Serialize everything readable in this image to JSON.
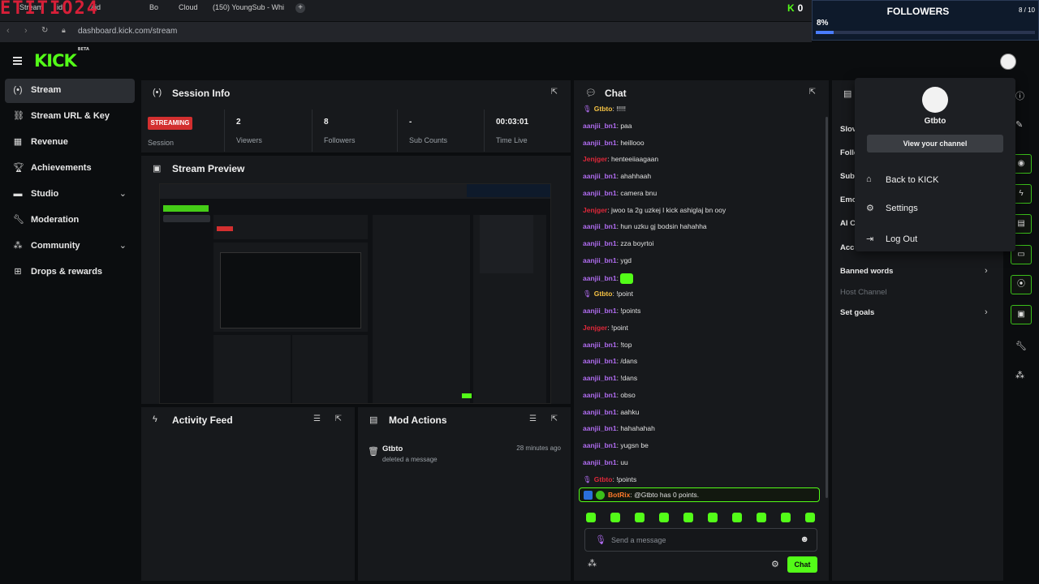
{
  "browser": {
    "tabs": [
      "Stream",
      "id",
      "aid",
      "Bo",
      "Cloud",
      "(150) YoungSub - Whi"
    ],
    "new_tab": "+",
    "url": "dashboard.kick.com/stream",
    "overlay_text": "ETITIO24"
  },
  "followers_widget": {
    "title": "FOLLOWERS",
    "count": "8 / 10",
    "percent_label": "8%",
    "progress": 0.08,
    "kick_count": "0"
  },
  "header": {
    "logo": "KICK",
    "logo_badge": "BETA"
  },
  "sidebar": {
    "items": [
      {
        "label": "Stream",
        "icon": "broadcast-icon",
        "active": true
      },
      {
        "label": "Stream URL & Key",
        "icon": "link-icon"
      },
      {
        "label": "Revenue",
        "icon": "revenue-icon"
      },
      {
        "label": "Achievements",
        "icon": "trophy-icon"
      },
      {
        "label": "Studio",
        "icon": "studio-icon",
        "expandable": true
      },
      {
        "label": "Moderation",
        "icon": "wrench-icon"
      },
      {
        "label": "Community",
        "icon": "community-icon",
        "expandable": true
      },
      {
        "label": "Drops & rewards",
        "icon": "drops-icon"
      }
    ]
  },
  "session_info": {
    "title": "Session Info",
    "status_badge": "STREAMING",
    "status_label": "Session",
    "stats": [
      {
        "value": "2",
        "label": "Viewers"
      },
      {
        "value": "8",
        "label": "Followers"
      },
      {
        "value": "-",
        "label": "Sub Counts"
      },
      {
        "value": "00:03:01",
        "label": "Time Live"
      }
    ]
  },
  "stream_preview": {
    "title": "Stream Preview"
  },
  "activity_feed": {
    "title": "Activity Feed"
  },
  "mod_actions": {
    "title": "Mod Actions",
    "entries": [
      {
        "user": "Gtbto",
        "action": "deleted a message",
        "time": "28 minutes ago"
      }
    ]
  },
  "chat": {
    "title": "Chat",
    "messages": [
      {
        "user": "Gtbto",
        "text": "!!!!!",
        "color": "gold",
        "badge": true
      },
      {
        "user": "aanjii_bn1",
        "text": "paa",
        "color": "purple"
      },
      {
        "user": "aanjii_bn1",
        "text": "heillooo",
        "color": "purple"
      },
      {
        "user": "Jenjger",
        "text": "henteeiiaagaan",
        "color": "red"
      },
      {
        "user": "aanjii_bn1",
        "text": "ahahhaah",
        "color": "purple"
      },
      {
        "user": "aanjii_bn1",
        "text": "camera bnu",
        "color": "purple"
      },
      {
        "user": "Jenjger",
        "text": "jwoo ta 2g uzkej l kick ashiglaj bn ooy",
        "color": "red"
      },
      {
        "user": "aanjii_bn1",
        "text": "hun uzku gj bodsin hahahha",
        "color": "purple"
      },
      {
        "user": "aanjii_bn1",
        "text": "zza boyrtoi",
        "color": "purple"
      },
      {
        "user": "aanjii_bn1",
        "text": "ygd",
        "color": "purple"
      },
      {
        "user": "aanjii_bn1",
        "text": "",
        "color": "purple",
        "emote": true
      },
      {
        "user": "Gtbto",
        "text": "!point",
        "color": "gold",
        "badge": true
      },
      {
        "user": "aanjii_bn1",
        "text": "!points",
        "color": "purple"
      },
      {
        "user": "Jenjger",
        "text": "!point",
        "color": "red"
      },
      {
        "user": "aanjii_bn1",
        "text": "!top",
        "color": "purple"
      },
      {
        "user": "aanjii_bn1",
        "text": "/dans",
        "color": "purple"
      },
      {
        "user": "aanjii_bn1",
        "text": "!dans",
        "color": "purple"
      },
      {
        "user": "aanjii_bn1",
        "text": "obso",
        "color": "purple"
      },
      {
        "user": "aanjii_bn1",
        "text": "aahku",
        "color": "purple"
      },
      {
        "user": "aanjii_bn1",
        "text": "hahahahah",
        "color": "purple"
      },
      {
        "user": "aanjii_bn1",
        "text": "yugsn be",
        "color": "purple"
      },
      {
        "user": "aanjii_bn1",
        "text": "uu",
        "color": "purple"
      },
      {
        "user": "Gtbto",
        "text": "!points",
        "color": "red",
        "badge": true
      }
    ],
    "bot_message": {
      "user": "BotRix",
      "text": "@Gtbto has 0 points."
    },
    "input_placeholder": "Send a message",
    "send_label": "Chat",
    "emote_count": 10
  },
  "user_menu": {
    "username": "Gtbto",
    "view_channel": "View your channel",
    "items": [
      {
        "label": "Back to KICK",
        "icon": "home-icon"
      },
      {
        "label": "Settings",
        "icon": "gear-icon"
      },
      {
        "label": "Log Out",
        "icon": "logout-icon"
      }
    ]
  },
  "chat_settings": {
    "rows": [
      {
        "label": "Slov",
        "y": 0
      },
      {
        "label": "Follo"
      },
      {
        "label": "Sub"
      },
      {
        "label": "Emo"
      },
      {
        "label": "AI C"
      },
      {
        "label": "Acc"
      }
    ],
    "banned_words": "Banned words",
    "host_channel": "Host Channel",
    "set_goals": "Set goals"
  },
  "colors": {
    "accent": "#53fc18",
    "streaming": "#d32f2f",
    "panel": "#17191c",
    "bg": "#0b0d0f"
  }
}
